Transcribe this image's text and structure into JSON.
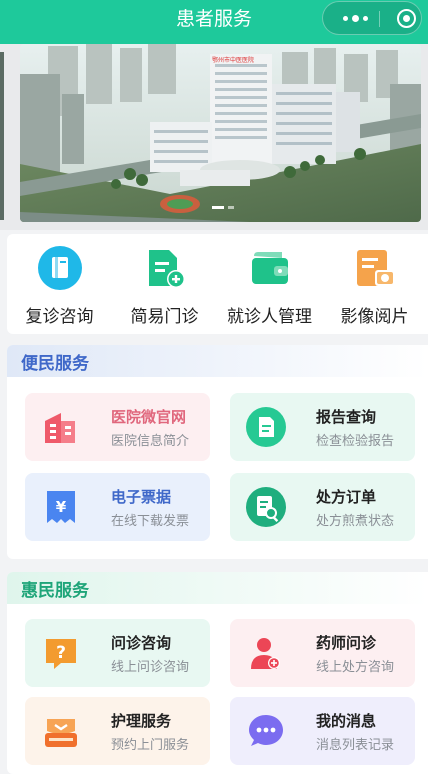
{
  "header": {
    "title": "患者服务"
  },
  "capsule": {
    "more_icon": "more-dots-icon",
    "close_icon": "close-target-icon"
  },
  "banner": {
    "image": "hospital-aerial-photo",
    "sign_text": "鄂州市中医医院"
  },
  "quick_menu": [
    {
      "label": "复诊咨询",
      "icon": "book-icon",
      "color": "#1fb8e8"
    },
    {
      "label": "简易门诊",
      "icon": "document-add-icon",
      "color": "#1fc28a"
    },
    {
      "label": "就诊人管理",
      "icon": "wallet-icon",
      "color": "#1fc28a"
    },
    {
      "label": "影像阅片",
      "icon": "image-camera-icon",
      "color": "#f5a34b"
    }
  ],
  "convenience": {
    "title": "便民服务",
    "cards": [
      {
        "title": "医院微官网",
        "subtitle": "医院信息简介",
        "icon": "building-icon",
        "bg": "#fdeff1",
        "title_color": "#e0677d"
      },
      {
        "title": "报告查询",
        "subtitle": "检查检验报告",
        "icon": "report-icon",
        "bg": "#e8f8f2",
        "title_color": "#222222"
      },
      {
        "title": "电子票据",
        "subtitle": "在线下载发票",
        "icon": "yuan-receipt-icon",
        "bg": "#e9f0fc",
        "title_color": "#3f68c9"
      },
      {
        "title": "处方订单",
        "subtitle": "处方煎煮状态",
        "icon": "prescription-search-icon",
        "bg": "#e8f8f2",
        "title_color": "#222222"
      }
    ]
  },
  "benefit": {
    "title": "惠民服务",
    "cards": [
      {
        "title": "问诊咨询",
        "subtitle": "线上问诊咨询",
        "icon": "question-chat-icon",
        "bg": "#e8f8f2"
      },
      {
        "title": "药师问诊",
        "subtitle": "线上处方咨询",
        "icon": "pharmacist-icon",
        "bg": "#fdeff1"
      },
      {
        "title": "护理服务",
        "subtitle": "预约上门服务",
        "icon": "nursing-icon",
        "bg": "#fdf3ea"
      },
      {
        "title": "我的消息",
        "subtitle": "消息列表记录",
        "icon": "message-icon",
        "bg": "#efeefc"
      }
    ]
  }
}
